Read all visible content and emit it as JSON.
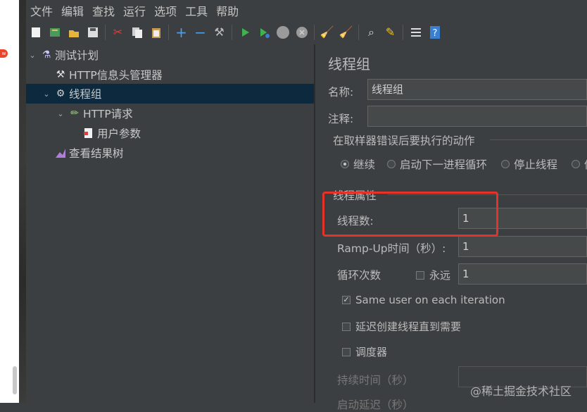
{
  "menu": [
    "文件",
    "编辑",
    "查找",
    "运行",
    "选项",
    "工具",
    "帮助"
  ],
  "left_badge": "w",
  "toolbar_icons": [
    "new-icon",
    "templates-icon",
    "open-icon",
    "save-icon",
    "cut-icon",
    "copy-icon",
    "paste-icon",
    "expand-icon",
    "collapse-icon",
    "toggle-icon",
    "start-icon",
    "start-no-pause-icon",
    "stop-icon",
    "shutdown-icon",
    "clear-icon",
    "clear-all-icon",
    "search-icon",
    "reset-search-icon",
    "function-helper-icon",
    "help-icon"
  ],
  "tree": {
    "test_plan": "测试计划",
    "header_manager": "HTTP信息头管理器",
    "thread_group": "线程组",
    "http_request": "HTTP请求",
    "user_params": "用户参数",
    "result_tree": "查看结果树"
  },
  "panel": {
    "title": "线程组",
    "name_label": "名称:",
    "name_value": "线程组",
    "comment_label": "注释:",
    "comment_value": "",
    "error_group_title": "在取样器错误后要执行的动作",
    "error_options": [
      "继续",
      "启动下一进程循环",
      "停止线程",
      "停"
    ],
    "error_selected": 0,
    "thread_props_title": "线程属性",
    "threads_label": "线程数:",
    "threads_value": "1",
    "rampup_label": "Ramp-Up时间（秒）:",
    "rampup_value": "1",
    "loop_label": "循环次数",
    "forever_label": "永远",
    "loop_value": "1",
    "same_user_label": "Same user on each iteration",
    "delay_label": "延迟创建线程直到需要",
    "scheduler_label": "调度器",
    "duration_label": "持续时间（秒）",
    "startup_delay_label": "启动延迟（秒）"
  },
  "watermark": "@稀土掘金技术社区",
  "colors": {
    "background": "#3c3f41",
    "selection": "#0d293e",
    "highlight_box": "#e5332a"
  }
}
